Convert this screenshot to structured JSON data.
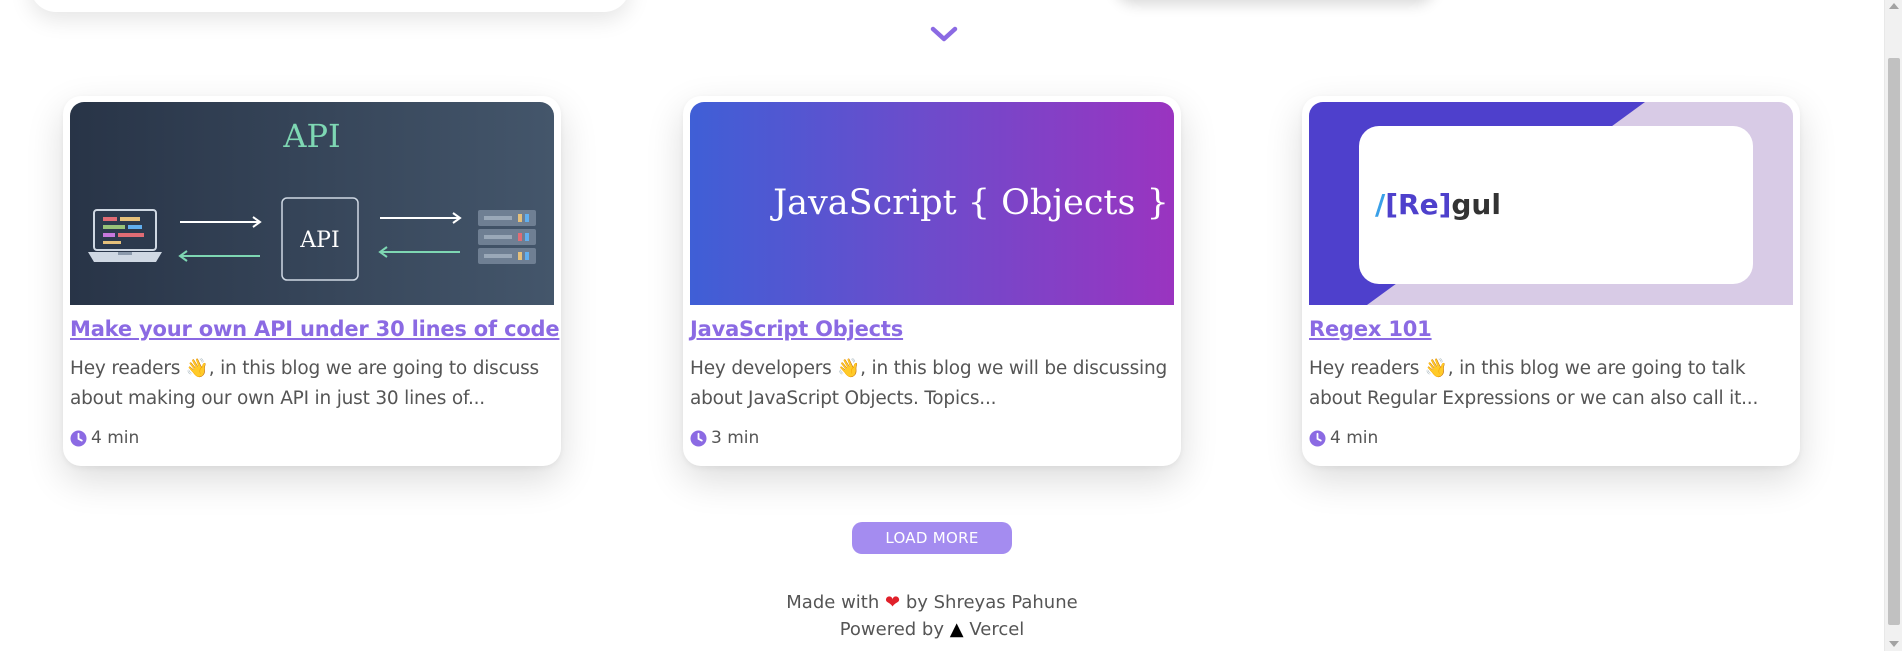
{
  "page": {
    "accent_color": "#8b6ae3",
    "button_color": "#a48cf0"
  },
  "scroll_indicator": {
    "icon": "chevron-down-icon"
  },
  "posts": [
    {
      "title": "Make your own API under 30 lines of code",
      "excerpt_before": "Hey readers ",
      "excerpt_after": ", in this blog we are going to discuss about making our own API in just 30 lines of...",
      "read_time": "4 min",
      "thumbnail": {
        "heading": "API",
        "center_label": "API"
      }
    },
    {
      "title": "JavaScript Objects",
      "excerpt_before": "Hey developers ",
      "excerpt_after": ", in this blog we will be discussing about JavaScript Objects. Topics...",
      "read_time": "3 min",
      "thumbnail": {
        "text": "JavaScript { Objects }"
      }
    },
    {
      "title": "Regex 101",
      "excerpt_before": "Hey readers ",
      "excerpt_after": ", in this blog we are going to talk about Regular Expressions or we can also call it...",
      "read_time": "4 min",
      "thumbnail": {
        "slash": "/",
        "bracketed": "[Re]",
        "rest": "gul"
      }
    }
  ],
  "wave_emoji": "👋",
  "load_more": {
    "label": "LOAD MORE"
  },
  "footer": {
    "made_with": "Made with",
    "heart": "❤",
    "by": "by Shreyas Pahune",
    "powered_by": "Powered by",
    "vercel_logo": "▲",
    "vercel": "Vercel"
  }
}
